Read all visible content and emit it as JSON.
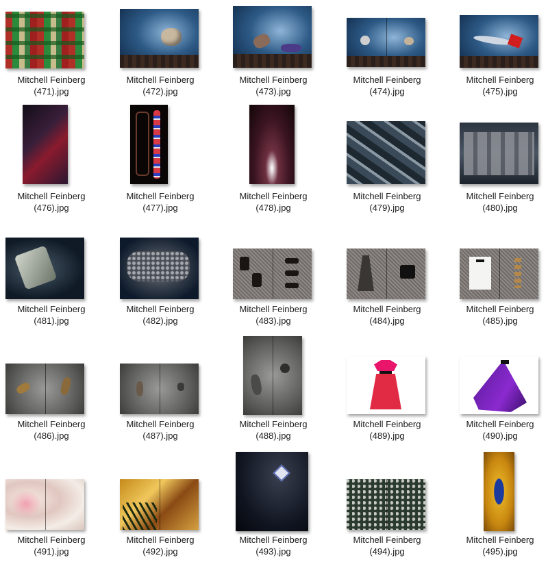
{
  "files": [
    {
      "name_line1": "Mitchell Feinberg",
      "name_line2": "(471).jpg"
    },
    {
      "name_line1": "Mitchell Feinberg",
      "name_line2": "(472).jpg"
    },
    {
      "name_line1": "Mitchell Feinberg",
      "name_line2": "(473).jpg"
    },
    {
      "name_line1": "Mitchell Feinberg",
      "name_line2": "(474).jpg"
    },
    {
      "name_line1": "Mitchell Feinberg",
      "name_line2": "(475).jpg"
    },
    {
      "name_line1": "Mitchell Feinberg",
      "name_line2": "(476).jpg"
    },
    {
      "name_line1": "Mitchell Feinberg",
      "name_line2": "(477).jpg"
    },
    {
      "name_line1": "Mitchell Feinberg",
      "name_line2": "(478).jpg"
    },
    {
      "name_line1": "Mitchell Feinberg",
      "name_line2": "(479).jpg"
    },
    {
      "name_line1": "Mitchell Feinberg",
      "name_line2": "(480).jpg"
    },
    {
      "name_line1": "Mitchell Feinberg",
      "name_line2": "(481).jpg"
    },
    {
      "name_line1": "Mitchell Feinberg",
      "name_line2": "(482).jpg"
    },
    {
      "name_line1": "Mitchell Feinberg",
      "name_line2": "(483).jpg"
    },
    {
      "name_line1": "Mitchell Feinberg",
      "name_line2": "(484).jpg"
    },
    {
      "name_line1": "Mitchell Feinberg",
      "name_line2": "(485).jpg"
    },
    {
      "name_line1": "Mitchell Feinberg",
      "name_line2": "(486).jpg"
    },
    {
      "name_line1": "Mitchell Feinberg",
      "name_line2": "(487).jpg"
    },
    {
      "name_line1": "Mitchell Feinberg",
      "name_line2": "(488).jpg"
    },
    {
      "name_line1": "Mitchell Feinberg",
      "name_line2": "(489).jpg"
    },
    {
      "name_line1": "Mitchell Feinberg",
      "name_line2": "(490).jpg"
    },
    {
      "name_line1": "Mitchell Feinberg",
      "name_line2": "(491).jpg"
    },
    {
      "name_line1": "Mitchell Feinberg",
      "name_line2": "(492).jpg"
    },
    {
      "name_line1": "Mitchell Feinberg",
      "name_line2": "(493).jpg"
    },
    {
      "name_line1": "Mitchell Feinberg",
      "name_line2": "(494).jpg"
    },
    {
      "name_line1": "Mitchell Feinberg",
      "name_line2": "(495).jpg"
    }
  ]
}
